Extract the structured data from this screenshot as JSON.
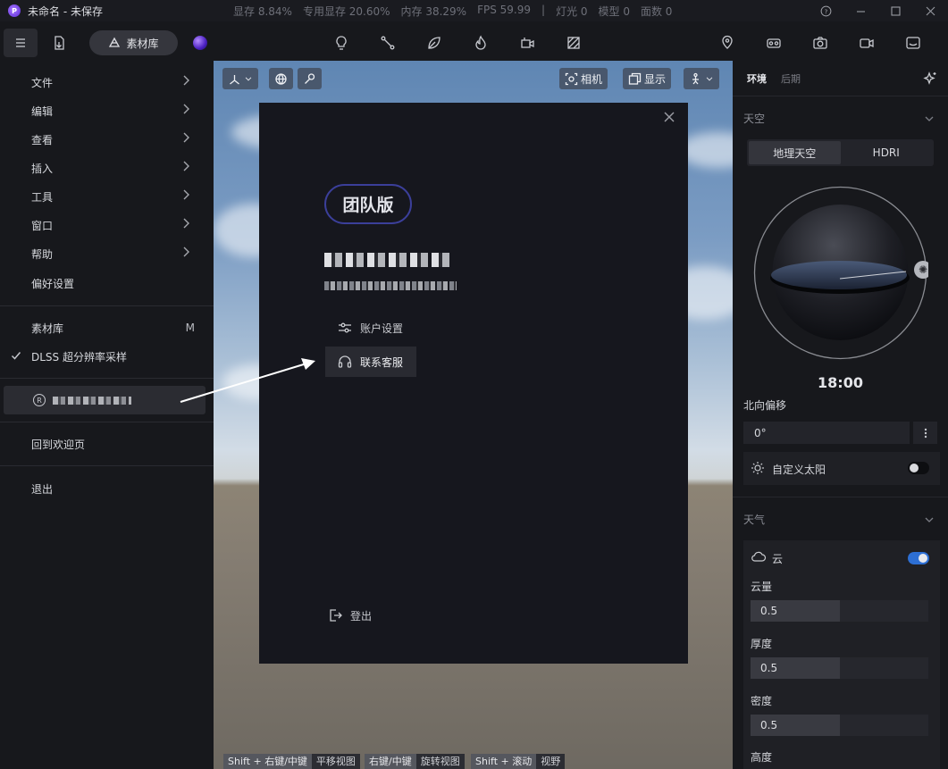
{
  "window": {
    "title": "未命名 - 未保存",
    "stats": [
      "显存 8.84%",
      "专用显存 20.60%",
      "内存 38.29%",
      "FPS 59.99",
      "|",
      "灯光 0",
      "模型 0",
      "面数 0"
    ]
  },
  "toolbar": {
    "library_label": "素材库"
  },
  "left_menu": {
    "items": [
      {
        "label": "文件"
      },
      {
        "label": "编辑"
      },
      {
        "label": "查看"
      },
      {
        "label": "插入"
      },
      {
        "label": "工具"
      },
      {
        "label": "窗口"
      },
      {
        "label": "帮助"
      },
      {
        "label": "偏好设置"
      }
    ],
    "library": {
      "label": "素材库",
      "shortcut": "M"
    },
    "dlss": {
      "label": "DLSS 超分辨率采样",
      "checked": true
    },
    "back_welcome": "回到欢迎页",
    "exit": "退出"
  },
  "viewport": {
    "camera_label": "相机",
    "display_label": "显示",
    "hints": [
      {
        "keys": "Shift + 右键/中键",
        "action": "平移视图"
      },
      {
        "keys": "右键/中键",
        "action": "旋转视图"
      },
      {
        "keys": "Shift + 滚动",
        "action": "视野"
      }
    ]
  },
  "account_modal": {
    "badge": "团队版",
    "account_settings": "账户设置",
    "contact_support": "联系客服",
    "logout": "登出"
  },
  "right_panel": {
    "tabs": [
      {
        "label": "环境",
        "active": true
      },
      {
        "label": "后期",
        "active": false
      }
    ],
    "sky": {
      "header": "天空",
      "modes": [
        {
          "label": "地理天空",
          "active": true
        },
        {
          "label": "HDRI",
          "active": false
        }
      ],
      "time": "18:00",
      "north_offset_label": "北向偏移",
      "north_offset_value": "0°",
      "custom_sun_label": "自定义太阳",
      "custom_sun_on": false
    },
    "weather": {
      "header": "天气",
      "cloud_label": "云",
      "cloud_on": true,
      "params": [
        {
          "label": "云量",
          "value": "0.5",
          "fraction": 0.5
        },
        {
          "label": "厚度",
          "value": "0.5",
          "fraction": 0.5
        },
        {
          "label": "密度",
          "value": "0.5",
          "fraction": 0.5
        },
        {
          "label": "高度"
        }
      ]
    }
  },
  "colors": {
    "accent_blue": "#2d6fd4",
    "badge_border": "#3b3f9a"
  }
}
